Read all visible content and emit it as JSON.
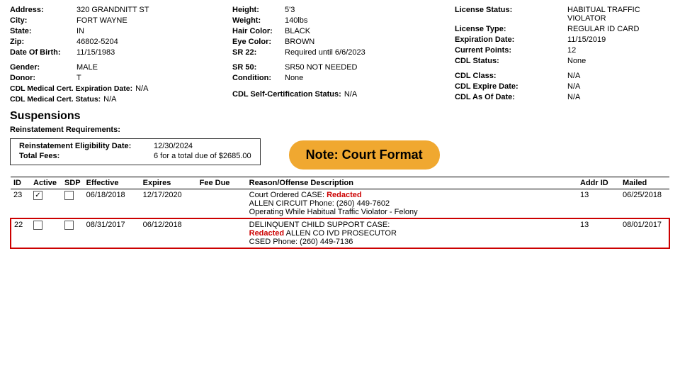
{
  "header": {
    "address_label": "Address:",
    "address_value": "320 GRANDNITT ST",
    "height_label": "Height:",
    "height_value": "5'3",
    "license_status_label": "License Status:",
    "license_status_value": "HABITUAL TRAFFIC VIOLATOR",
    "city_label": "City:",
    "city_value": "FORT WAYNE",
    "weight_label": "Weight:",
    "weight_value": "140lbs",
    "license_type_label": "License Type:",
    "license_type_value": "REGULAR ID CARD",
    "state_label": "State:",
    "state_value": "IN",
    "hair_color_label": "Hair Color:",
    "hair_color_value": "BLACK",
    "expiration_date_label": "Expiration Date:",
    "expiration_date_value": "11/15/2019",
    "zip_label": "Zip:",
    "zip_value": "46802-5204",
    "eye_color_label": "Eye Color:",
    "eye_color_value": "BROWN",
    "current_points_label": "Current Points:",
    "current_points_value": "12",
    "dob_label": "Date Of Birth:",
    "dob_value": "11/15/1983",
    "sr22_label": "SR 22:",
    "sr22_value": "Required until 6/6/2023",
    "cdl_status_label": "CDL Status:",
    "cdl_status_value": "None",
    "gender_label": "Gender:",
    "gender_value": "MALE",
    "sr50_label": "SR 50:",
    "sr50_value": "SR50 NOT NEEDED",
    "cdl_class_label": "CDL Class:",
    "cdl_class_value": "N/A",
    "donor_label": "Donor:",
    "donor_value": "T",
    "condition_label": "Condition:",
    "condition_value": "None",
    "cdl_expire_label": "CDL Expire Date:",
    "cdl_expire_value": "N/A",
    "cdl_med_exp_label": "CDL Medical Cert. Expiration Date:",
    "cdl_med_exp_value": "N/A",
    "cdl_as_of_label": "CDL As Of Date:",
    "cdl_as_of_value": "N/A",
    "cdl_med_status_label": "CDL Medical Cert. Status:",
    "cdl_med_status_value": "N/A",
    "cdl_self_cert_label": "CDL Self-Certification Status:",
    "cdl_self_cert_value": "N/A"
  },
  "suspensions": {
    "section_title": "Suspensions",
    "reinstatement_requirements_label": "Reinstatement Requirements:",
    "eligibility_date_label": "Reinstatement Eligibility Date:",
    "eligibility_date_value": "12/30/2024",
    "total_fees_label": "Total Fees:",
    "total_fees_value": "6 for a total due of $2685.00",
    "note_label": "Note:  Court Format"
  },
  "table": {
    "headers": [
      "ID",
      "Active",
      "SDP",
      "Effective",
      "Expires",
      "Fee Due",
      "Reason/Offense Description",
      "Addr ID",
      "Mailed"
    ],
    "rows": [
      {
        "id": "23",
        "active": true,
        "sdp": false,
        "effective": "06/18/2018",
        "expires": "12/17/2020",
        "fee_due": "",
        "reason_line1": "Court Ordered  CASE:  ",
        "reason_redacted": "Redacted",
        "reason_line2": "ALLEN CIRCUIT Phone: (260) 449-7602",
        "reason_line3": "Operating While Habitual Traffic Violator - Felony",
        "addr_id": "13",
        "mailed": "06/25/2018",
        "highlighted": false
      },
      {
        "id": "22",
        "active": false,
        "sdp": false,
        "effective": "08/31/2017",
        "expires": "06/12/2018",
        "fee_due": "",
        "reason_line1": "DELINQUENT CHILD SUPPORT  CASE:",
        "reason_redacted": "Redacted",
        "reason_line2": "  ALLEN CO IVD PROSECUTOR",
        "reason_line3": "CSED Phone: (260) 449-7136",
        "addr_id": "13",
        "mailed": "08/01/2017",
        "highlighted": true
      }
    ]
  }
}
